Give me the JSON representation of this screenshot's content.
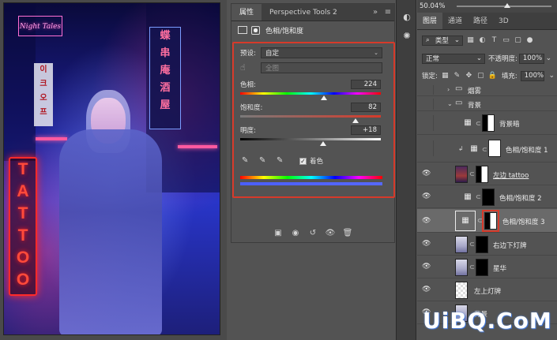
{
  "canvas": {
    "neon_top_sign": "Night Tales",
    "tattoo_letters": [
      "T",
      "A",
      "T",
      "T",
      "O",
      "O"
    ],
    "hanging_sign_chars": [
      "蝶",
      "串",
      "庵",
      "酒",
      "屋"
    ],
    "left_sign_chars": [
      "이",
      "크",
      "오",
      "프"
    ]
  },
  "properties_panel": {
    "tabs": [
      {
        "label": "属性",
        "active": true
      },
      {
        "label": "Perspective Tools 2",
        "active": false
      }
    ],
    "header_title": "色相/饱和度",
    "preset_label": "预设:",
    "preset_value": "自定",
    "channel_value": "全图",
    "hue": {
      "label": "色相:",
      "value": "224",
      "fraction": 0.595
    },
    "saturation": {
      "label": "饱和度:",
      "value": "82",
      "fraction": 0.82
    },
    "lightness": {
      "label": "明度:",
      "value": "+18",
      "fraction": 0.59
    },
    "colorize_label": "着色",
    "colorize_checked": true,
    "footer_icons": [
      "clip-to-layer-icon",
      "view-previous-icon",
      "reset-icon",
      "visibility-icon",
      "delete-icon"
    ]
  },
  "layers_panel": {
    "zoom": "50.04%",
    "tabs": [
      {
        "label": "图层",
        "active": true
      },
      {
        "label": "通道",
        "active": false
      },
      {
        "label": "路径",
        "active": false
      },
      {
        "label": "3D",
        "active": false
      }
    ],
    "filter_kind": "类型",
    "blend_mode": "正常",
    "opacity_label": "不透明度:",
    "opacity_value": "100%",
    "lock_label": "锁定:",
    "fill_label": "填充:",
    "fill_value": "100%",
    "layers": [
      {
        "name": "烟雾",
        "visible": false,
        "type": "group-collapsed"
      },
      {
        "name": "背景",
        "visible": false,
        "type": "group-open"
      },
      {
        "name": "背景暗",
        "visible": false,
        "type": "adjustment"
      },
      {
        "name": "色相/饱和度 1",
        "visible": false,
        "type": "adjustment-clipped"
      },
      {
        "name": "左边 tattoo",
        "visible": true,
        "type": "image"
      },
      {
        "name": "色相/饱和度 2",
        "visible": true,
        "type": "adjustment"
      },
      {
        "name": "色相/饱和度 3",
        "visible": true,
        "type": "adjustment",
        "selected": true
      },
      {
        "name": "右边下灯牌",
        "visible": true,
        "type": "image"
      },
      {
        "name": "星华",
        "visible": true,
        "type": "image"
      },
      {
        "name": "左上灯牌",
        "visible": true,
        "type": "image"
      },
      {
        "name": "背景",
        "visible": true,
        "type": "image"
      }
    ]
  },
  "watermark": "UiBQ.CoM"
}
